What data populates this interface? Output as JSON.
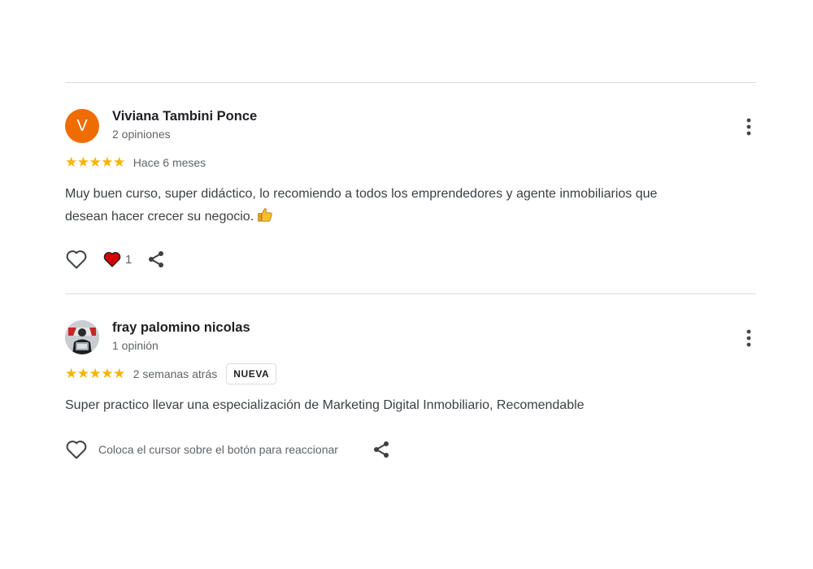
{
  "reviews": [
    {
      "author": "Viviana Tambini Ponce",
      "avatar_letter": "V",
      "review_count": "2 opiniones",
      "stars": "★★★★★",
      "rating": 5,
      "time": "Hace 6 meses",
      "text_line1": "Muy buen curso, super didáctico, lo recomiendo a todos los emprendedores y agente inmobiliarios que",
      "text_line2": "desean hacer crecer su negocio.",
      "emoji": "thumbs-up",
      "reaction_count": "1",
      "icons": [
        "heart-outline-icon",
        "heart-filled-icon",
        "share-icon",
        "more-vert-icon"
      ]
    },
    {
      "author": "fray palomino nicolas",
      "review_count": "1 opinión",
      "stars": "★★★★★",
      "rating": 5,
      "time": "2 semanas atrás",
      "badge": "NUEVA",
      "text": "Super practico llevar una especialización de Marketing Digital Inmobiliario, Recomendable",
      "hover_hint": "Coloca el cursor sobre el botón para reaccionar",
      "icons": [
        "heart-outline-icon",
        "share-icon",
        "more-vert-icon"
      ]
    }
  ],
  "colors": {
    "star": "#f6b400",
    "avatar_bg": "#ef6c00",
    "heart_filled": "#d50000",
    "divider": "#dadce0"
  }
}
